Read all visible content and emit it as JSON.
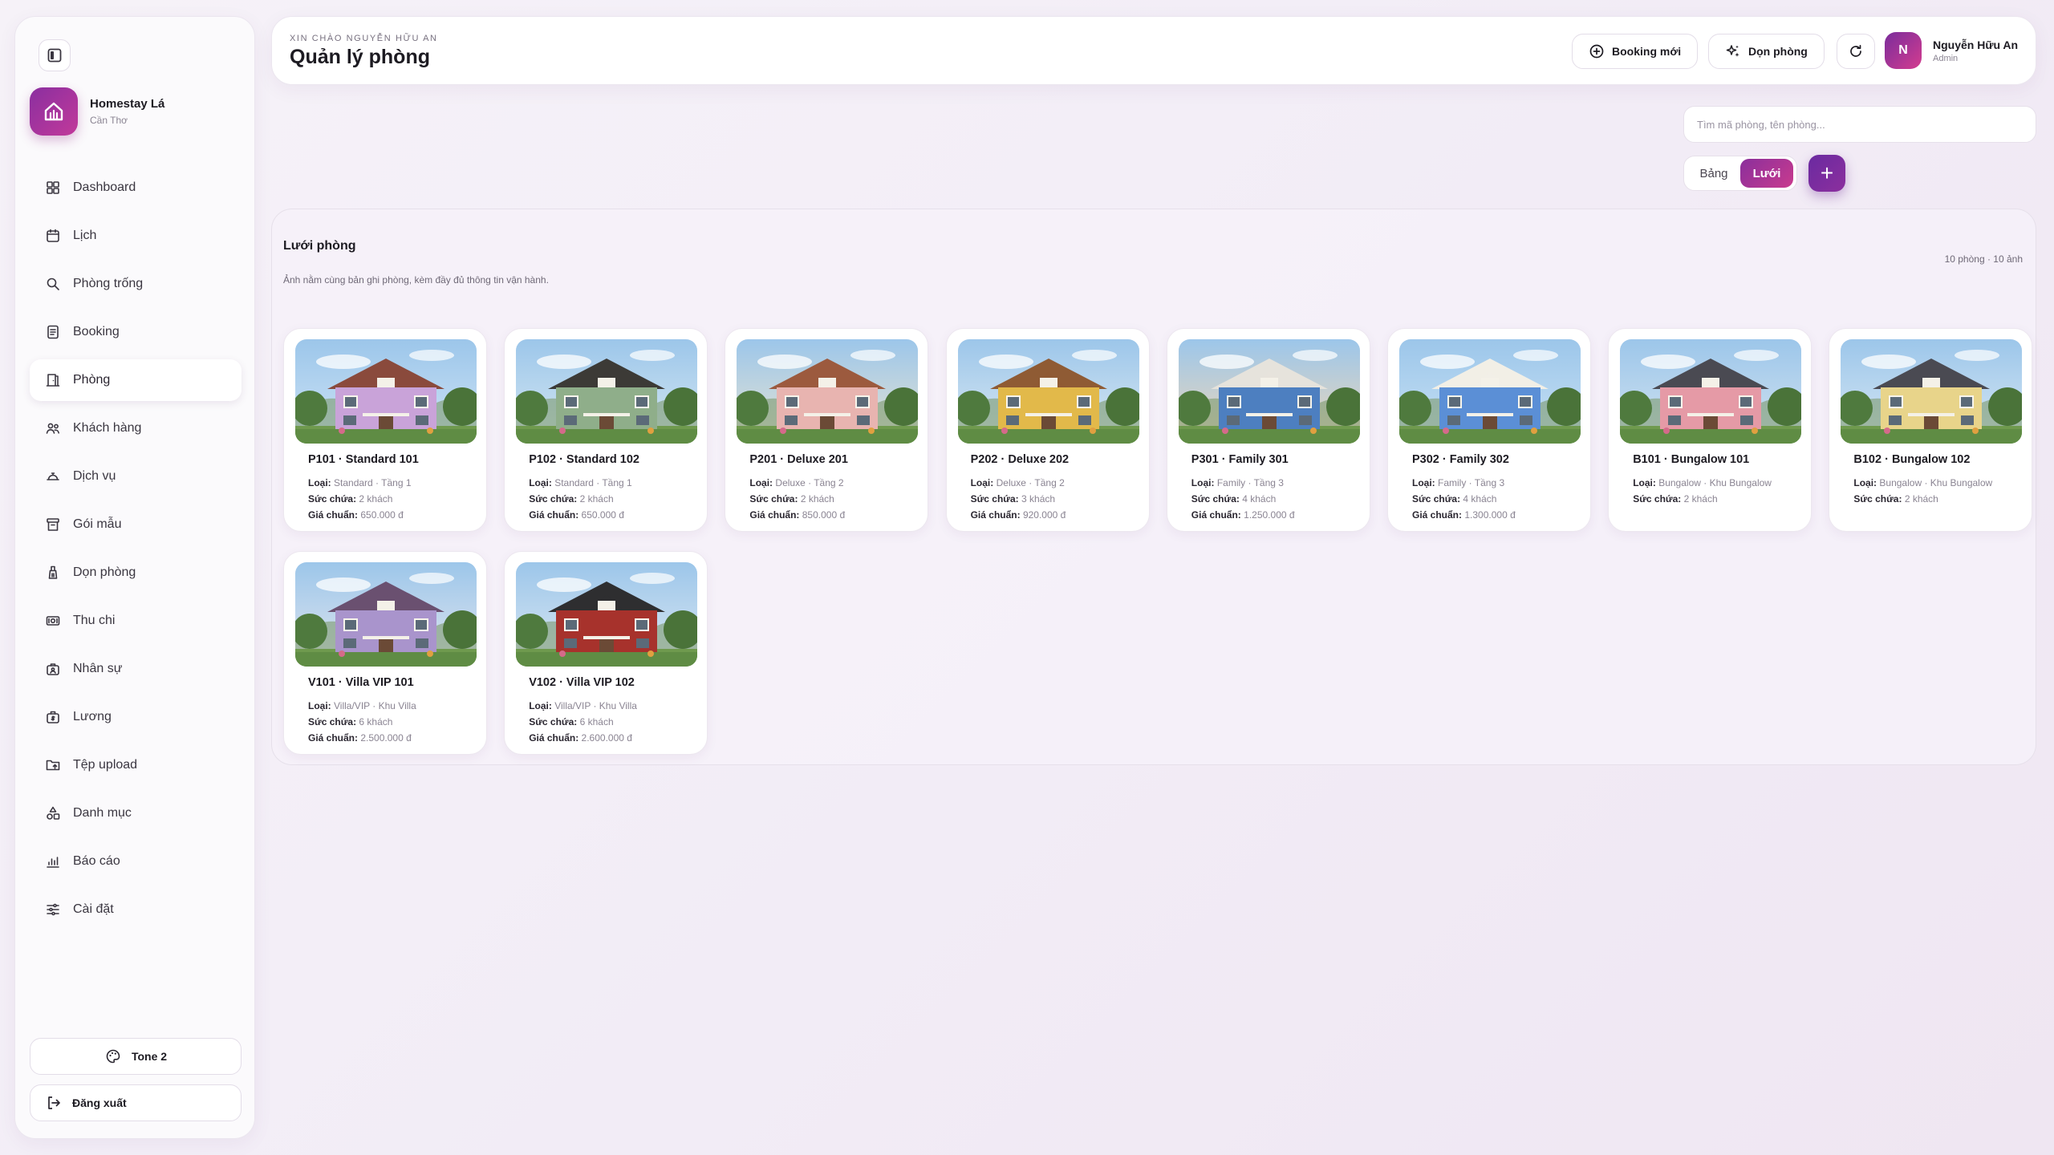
{
  "sidebar": {
    "brand_name": "Homestay Lá",
    "brand_location": "Cần Thơ",
    "items": [
      {
        "label": "Dashboard",
        "icon": "dashboard-icon"
      },
      {
        "label": "Lịch",
        "icon": "calendar-icon"
      },
      {
        "label": "Phòng trống",
        "icon": "search-icon"
      },
      {
        "label": "Booking",
        "icon": "booking-icon"
      },
      {
        "label": "Phòng",
        "icon": "door-icon",
        "active": true
      },
      {
        "label": "Khách hàng",
        "icon": "users-icon"
      },
      {
        "label": "Dịch vụ",
        "icon": "service-bell-icon"
      },
      {
        "label": "Gói mẫu",
        "icon": "package-icon"
      },
      {
        "label": "Dọn phòng",
        "icon": "cleaning-icon"
      },
      {
        "label": "Thu chi",
        "icon": "money-icon"
      },
      {
        "label": "Nhân sự",
        "icon": "staff-icon"
      },
      {
        "label": "Lương",
        "icon": "payroll-icon"
      },
      {
        "label": "Tệp upload",
        "icon": "folder-upload-icon"
      },
      {
        "label": "Danh mục",
        "icon": "shapes-icon"
      },
      {
        "label": "Báo cáo",
        "icon": "chart-icon"
      },
      {
        "label": "Cài đặt",
        "icon": "settings-sliders-icon"
      }
    ],
    "tone_label": "Tone 2",
    "logout_label": "Đăng xuất"
  },
  "header": {
    "greeting": "XIN CHÀO NGUYỄN HỮU AN",
    "title": "Quản lý phòng",
    "booking_btn": "Booking mới",
    "clean_btn": "Dọn phòng",
    "user_initial": "N",
    "user_name": "Nguyễn Hữu An",
    "user_role": "Admin"
  },
  "toolbar": {
    "search_placeholder": "Tìm mã phòng, tên phòng...",
    "view_table": "Bảng",
    "view_grid": "Lưới",
    "add_symbol": "+"
  },
  "grid": {
    "title": "Lưới phòng",
    "description": "Ảnh nằm cùng bản ghi phòng, kèm đầy đủ thông tin vận hành.",
    "count": "10 phòng · 10 ảnh",
    "label_type": "Loại:",
    "label_capacity": "Sức chứa:",
    "label_price": "Giá chuẩn:",
    "rooms": [
      {
        "title": "P101 · Standard 101",
        "type": "Standard · Tầng 1",
        "capacity": "2 khách",
        "price": "650.000 đ",
        "wall": "#c9a3d9",
        "roof": "#8a4a3c"
      },
      {
        "title": "P102 · Standard 102",
        "type": "Standard · Tầng 1",
        "capacity": "2 khách",
        "price": "650.000 đ",
        "wall": "#8fae8a",
        "roof": "#3c3a36"
      },
      {
        "title": "P201 · Deluxe 201",
        "type": "Deluxe · Tầng 2",
        "capacity": "2 khách",
        "price": "850.000 đ",
        "wall": "#e8b4b0",
        "roof": "#9c5a3e"
      },
      {
        "title": "P202 · Deluxe 202",
        "type": "Deluxe · Tầng 2",
        "capacity": "3 khách",
        "price": "920.000 đ",
        "wall": "#e2b94a",
        "roof": "#8f5b34"
      },
      {
        "title": "P301 · Family 301",
        "type": "Family · Tầng 3",
        "capacity": "4 khách",
        "price": "1.250.000 đ",
        "wall": "#4d7fc0",
        "roof": "#e6e3dc"
      },
      {
        "title": "P302 · Family 302",
        "type": "Family · Tầng 3",
        "capacity": "4 khách",
        "price": "1.300.000 đ",
        "wall": "#5b8fd6",
        "roof": "#f2efe6"
      },
      {
        "title": "B101 · Bungalow 101",
        "type": "Bungalow · Khu Bungalow",
        "capacity": "2 khách",
        "price": "",
        "wall": "#e59aa6",
        "roof": "#4a4a52"
      },
      {
        "title": "B102 · Bungalow 102",
        "type": "Bungalow · Khu Bungalow",
        "capacity": "2 khách",
        "price": "",
        "wall": "#e8d48a",
        "roof": "#4a4a52"
      },
      {
        "title": "V101 · Villa VIP 101",
        "type": "Villa/VIP · Khu Villa",
        "capacity": "6 khách",
        "price": "2.500.000 đ",
        "wall": "#a994cc",
        "roof": "#6a5070"
      },
      {
        "title": "V102 · Villa VIP 102",
        "type": "Villa/VIP · Khu Villa",
        "capacity": "6 khách",
        "price": "2.600.000 đ",
        "wall": "#a7322c",
        "roof": "#2e2e30"
      }
    ]
  }
}
